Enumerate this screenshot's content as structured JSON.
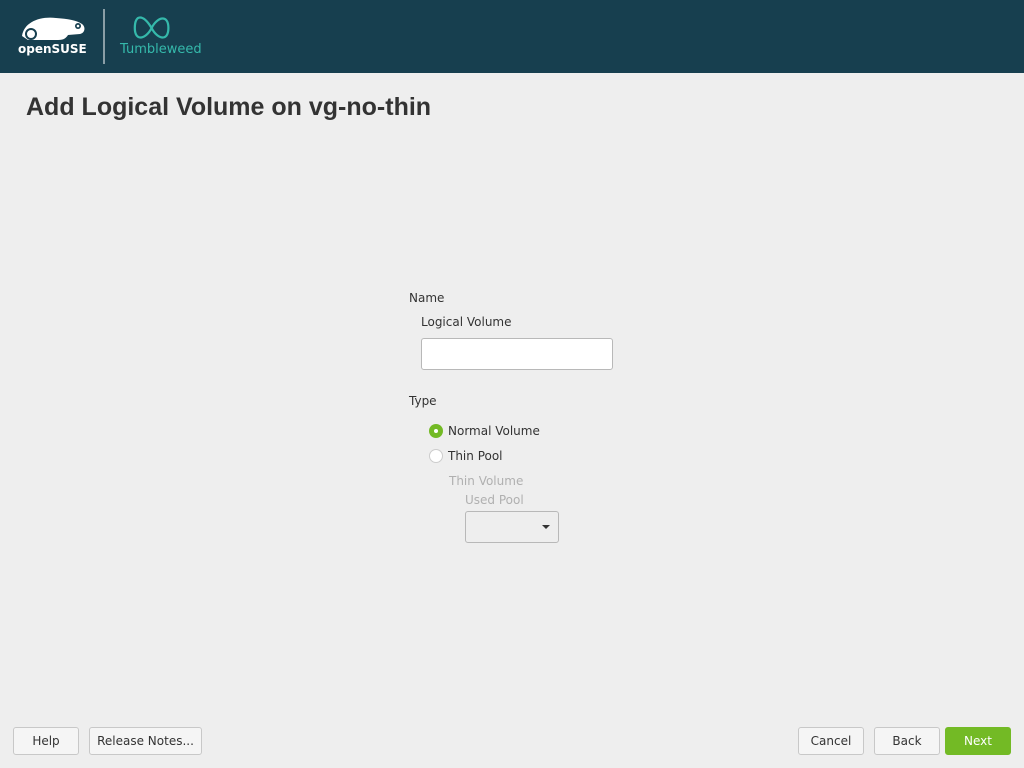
{
  "header": {
    "brand": "openSUSE",
    "product": "Tumbleweed"
  },
  "page_title": "Add Logical Volume on vg-no-thin",
  "form": {
    "name_label": "Name",
    "lv_label": "Logical Volume",
    "lv_value": "",
    "type_label": "Type",
    "normal_volume": "Normal Volume",
    "thin_pool": "Thin Pool",
    "thin_volume": "Thin Volume",
    "used_pool": "Used Pool",
    "selected_type": "Normal Volume"
  },
  "buttons": {
    "help": "Help",
    "release_notes": "Release Notes...",
    "cancel": "Cancel",
    "back": "Back",
    "next": "Next"
  },
  "colors": {
    "header": "#173f4f",
    "accent": "#73ba25",
    "tumbleweed": "#35b9ab"
  }
}
